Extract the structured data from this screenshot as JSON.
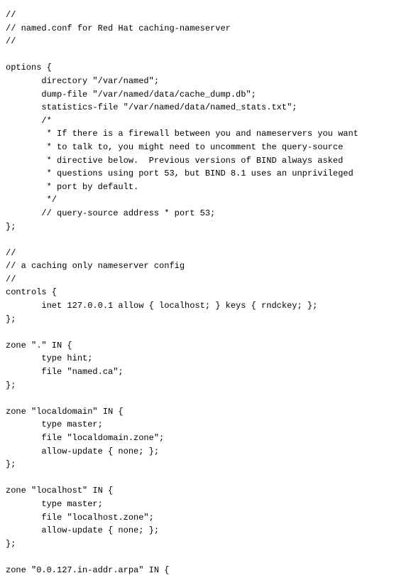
{
  "lines": [
    "//",
    "// named.conf for Red Hat caching-nameserver",
    "//",
    "",
    "options {",
    "       directory \"/var/named\";",
    "       dump-file \"/var/named/data/cache_dump.db\";",
    "       statistics-file \"/var/named/data/named_stats.txt\";",
    "       /*",
    "        * If there is a firewall between you and nameservers you want",
    "        * to talk to, you might need to uncomment the query-source",
    "        * directive below.  Previous versions of BIND always asked",
    "        * questions using port 53, but BIND 8.1 uses an unprivileged",
    "        * port by default.",
    "        */",
    "       // query-source address * port 53;",
    "};",
    "",
    "//",
    "// a caching only nameserver config",
    "//",
    "controls {",
    "       inet 127.0.0.1 allow { localhost; } keys { rndckey; };",
    "};",
    "",
    "zone \".\" IN {",
    "       type hint;",
    "       file \"named.ca\";",
    "};",
    "",
    "zone \"localdomain\" IN {",
    "       type master;",
    "       file \"localdomain.zone\";",
    "       allow-update { none; };",
    "};",
    "",
    "zone \"localhost\" IN {",
    "       type master;",
    "       file \"localhost.zone\";",
    "       allow-update { none; };",
    "};",
    "",
    "zone \"0.0.127.in-addr.arpa\" IN {"
  ]
}
